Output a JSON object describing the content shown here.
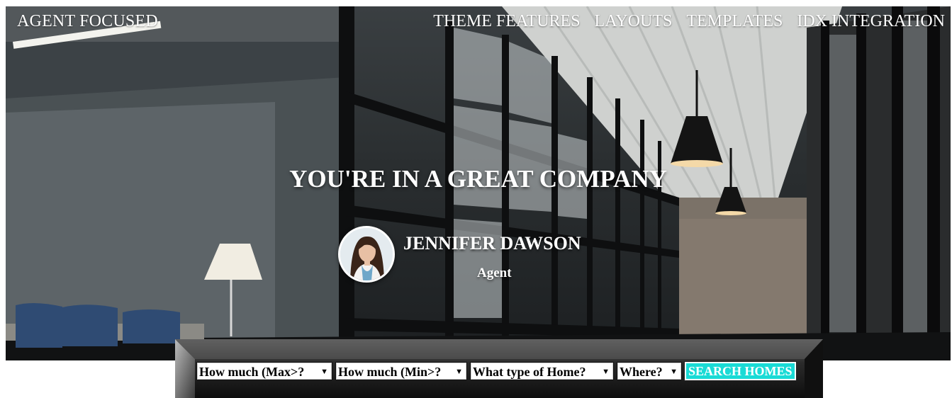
{
  "header": {
    "brand": "AGENT FOCUSED",
    "nav": [
      "THEME FEATURES",
      "LAYOUTS",
      "TEMPLATES",
      "IDX INTEGRATION"
    ]
  },
  "hero": {
    "headline": "YOU'RE IN A GREAT COMPANY"
  },
  "agent": {
    "name": "JENNIFER DAWSON",
    "role": "Agent"
  },
  "search": {
    "fields": [
      {
        "selected": "How much (Max>?"
      },
      {
        "selected": "How much (Min>?"
      },
      {
        "selected": "What type of Home?"
      },
      {
        "selected": "Where?"
      }
    ],
    "button_label": "SEARCH HOMES"
  },
  "colors": {
    "accent": "#19dbd6",
    "text": "#ffffff"
  }
}
